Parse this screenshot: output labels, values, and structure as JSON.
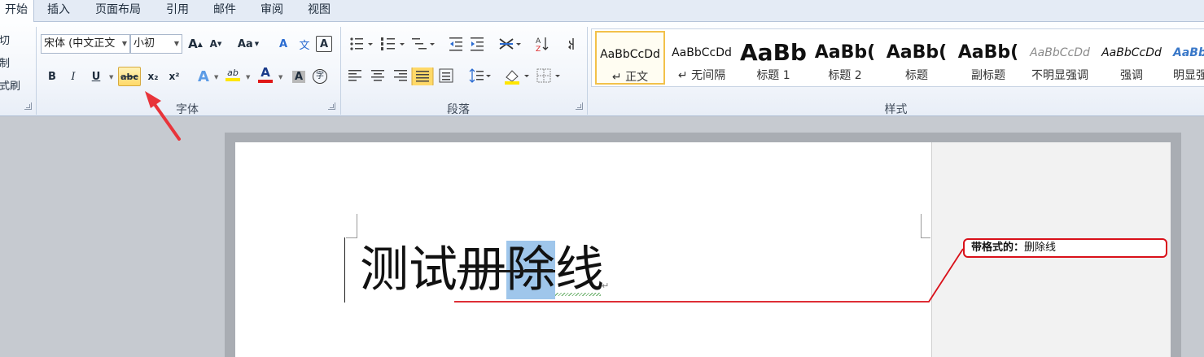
{
  "tabs": [
    "开始",
    "插入",
    "页面布局",
    "引用",
    "邮件",
    "审阅",
    "视图"
  ],
  "active_tab": "开始",
  "clipboard": {
    "cut": "剪切",
    "copy": "复制",
    "format_painter": "格式刷"
  },
  "font_group": {
    "label": "字体",
    "font_name": "宋体 (中文正文",
    "font_size": "小初",
    "grow_font": "A",
    "shrink_font": "A",
    "change_case": "Aa",
    "clear_format": "A",
    "phonetic": "文",
    "char_border": "A",
    "bold": "B",
    "italic": "I",
    "underline": "U",
    "strikethrough": "abc",
    "subscript": "x₂",
    "superscript": "x²",
    "text_effect": "A",
    "highlight": "ab",
    "font_color": "A",
    "char_shading": "A",
    "enclose_char": "字"
  },
  "paragraph_group": {
    "label": "段落",
    "line_spacing": "↕",
    "sort": "A↓Z"
  },
  "styles_group": {
    "label": "样式",
    "items": [
      {
        "sample": "AaBbCcDd",
        "name": "↵ 正文",
        "selected": true
      },
      {
        "sample": "AaBbCcDd",
        "name": "↵ 无间隔",
        "selected": false
      },
      {
        "sample": "AaBb",
        "name": "标题 1",
        "selected": false
      },
      {
        "sample": "AaBb(",
        "name": "标题 2",
        "selected": false
      },
      {
        "sample": "AaBb(",
        "name": "标题",
        "selected": false
      },
      {
        "sample": "AaBb(",
        "name": "副标题",
        "selected": false
      },
      {
        "sample": "AaBbCcDd",
        "name": "不明显强调",
        "selected": false
      },
      {
        "sample": "AaBbCcDd",
        "name": "强调",
        "selected": false
      },
      {
        "sample": "AaBb",
        "name": "明显强",
        "selected": false
      }
    ]
  },
  "document": {
    "before": "测试",
    "deleted_unselected": "册",
    "deleted_selected": "除",
    "after": "线",
    "paragraph_mark": "↵"
  },
  "balloon": {
    "prefix": "带格式的：",
    "text": "删除线"
  },
  "colors": {
    "accent_arrow": "#e8343a",
    "balloon_border": "#d9111a",
    "selection": "#9fc6eb",
    "font_color_bar": "#e01818",
    "highlight_bar": "#ffe600"
  }
}
